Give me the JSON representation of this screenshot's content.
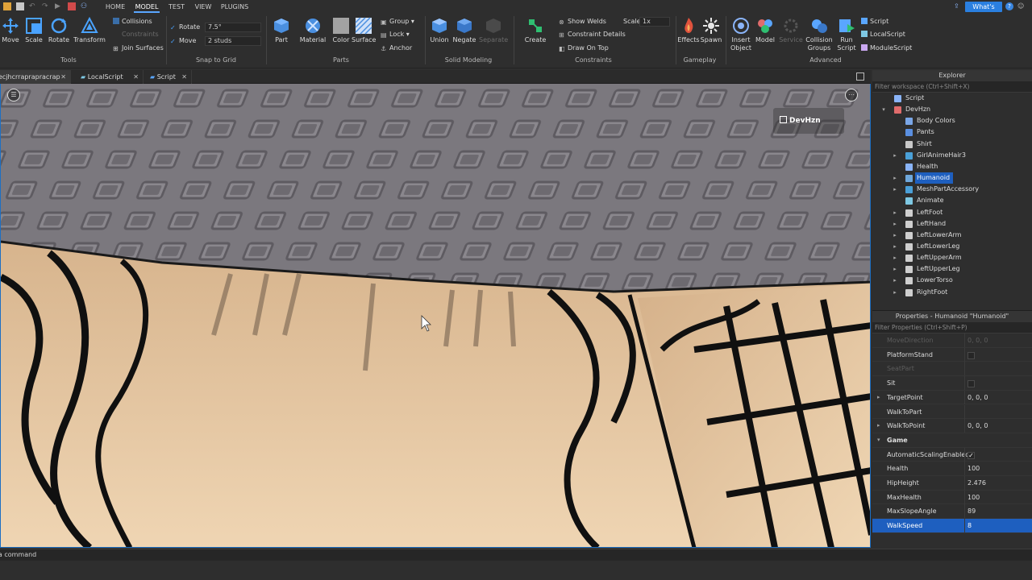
{
  "menu": {
    "tabs": [
      "HOME",
      "MODEL",
      "TEST",
      "VIEW",
      "PLUGINS"
    ],
    "active_tab": "MODEL",
    "whats_new": "What's New"
  },
  "ribbon": {
    "tools": {
      "move": "Move",
      "scale": "Scale",
      "rotate": "Rotate",
      "transform": "Transform",
      "collisions": "Collisions",
      "constraints": "Constraints",
      "join_surfaces": "Join Surfaces",
      "title": "Tools"
    },
    "snap": {
      "rotate_label": "Rotate",
      "rotate_value": "7.5°",
      "move_label": "Move",
      "move_value": "2 studs",
      "title": "Snap to Grid"
    },
    "parts": {
      "part": "Part",
      "material": "Material",
      "color": "Color",
      "surface": "Surface",
      "group": "Group",
      "lock": "Lock",
      "anchor": "Anchor",
      "title": "Parts"
    },
    "solid": {
      "union": "Union",
      "negate": "Negate",
      "separate": "Separate",
      "title": "Solid Modeling"
    },
    "constraints": {
      "create": "Create",
      "show_welds": "Show Welds",
      "scale_label": "Scale",
      "scale_value": "1x",
      "constraint_details": "Constraint Details",
      "draw_on_top": "Draw On Top",
      "title": "Constraints"
    },
    "gameplay": {
      "effects": "Effects",
      "spawn": "Spawn",
      "title": "Gameplay"
    },
    "advanced": {
      "insert_object": "Insert Object",
      "model": "Model",
      "service": "Service",
      "collision_groups": "Collision Groups",
      "run_script": "Run Script",
      "script": "Script",
      "local_script": "LocalScript",
      "module_script": "ModuleScript",
      "title": "Advanced"
    }
  },
  "doc_tabs": [
    {
      "label": "ecjhcrraprapracrap"
    },
    {
      "label": "LocalScript"
    },
    {
      "label": "Script"
    }
  ],
  "viewport": {
    "badge": "DevHzn"
  },
  "explorer": {
    "title": "Explorer",
    "filter_placeholder": "Filter workspace (Ctrl+Shift+X)",
    "items": [
      {
        "label": "Script",
        "icon": "script-icon",
        "color": "#8ab4f8"
      },
      {
        "label": "DevHzn",
        "icon": "model-icon",
        "color": "#e06c6c"
      },
      {
        "label": "Body Colors",
        "icon": "body-colors-icon",
        "color": "#7aa6e6"
      },
      {
        "label": "Pants",
        "icon": "pants-icon",
        "color": "#5a8fe0"
      },
      {
        "label": "Shirt",
        "icon": "shirt-icon",
        "color": "#c8c8c8"
      },
      {
        "label": "GirlAnimeHair3",
        "icon": "accessory-icon",
        "color": "#4aa0d8"
      },
      {
        "label": "Health",
        "icon": "script-icon",
        "color": "#8ab4f8"
      },
      {
        "label": "Humanoid",
        "icon": "humanoid-icon",
        "color": "#6fa8dc"
      },
      {
        "label": "MeshPartAccessory",
        "icon": "accessory-icon",
        "color": "#4aa0d8"
      },
      {
        "label": "Animate",
        "icon": "localscript-icon",
        "color": "#7ec8e3"
      },
      {
        "label": "LeftFoot",
        "icon": "meshpart-icon",
        "color": "#cfcfcf"
      },
      {
        "label": "LeftHand",
        "icon": "meshpart-icon",
        "color": "#cfcfcf"
      },
      {
        "label": "LeftLowerArm",
        "icon": "meshpart-icon",
        "color": "#cfcfcf"
      },
      {
        "label": "LeftLowerLeg",
        "icon": "meshpart-icon",
        "color": "#cfcfcf"
      },
      {
        "label": "LeftUpperArm",
        "icon": "meshpart-icon",
        "color": "#cfcfcf"
      },
      {
        "label": "LeftUpperLeg",
        "icon": "meshpart-icon",
        "color": "#cfcfcf"
      },
      {
        "label": "LowerTorso",
        "icon": "meshpart-icon",
        "color": "#cfcfcf"
      },
      {
        "label": "RightFoot",
        "icon": "meshpart-icon",
        "color": "#cfcfcf"
      }
    ]
  },
  "properties": {
    "title": "Properties - Humanoid \"Humanoid\"",
    "filter_placeholder": "Filter Properties (Ctrl+Shift+P)",
    "rows": [
      {
        "name": "MoveDirection",
        "value": "0, 0, 0",
        "disabled": true
      },
      {
        "name": "PlatformStand",
        "check": false
      },
      {
        "name": "SeatPart",
        "value": "",
        "disabled": true
      },
      {
        "name": "Sit",
        "check": false
      },
      {
        "name": "TargetPoint",
        "value": "0, 0, 0",
        "expandable": true
      },
      {
        "name": "WalkToPart",
        "value": ""
      },
      {
        "name": "WalkToPoint",
        "value": "0, 0, 0",
        "expandable": true
      },
      {
        "name": "Game",
        "category": true
      },
      {
        "name": "AutomaticScalingEnabled",
        "check": true
      },
      {
        "name": "Health",
        "value": "100"
      },
      {
        "name": "HipHeight",
        "value": "2.476"
      },
      {
        "name": "MaxHealth",
        "value": "100"
      },
      {
        "name": "MaxSlopeAngle",
        "value": "89"
      },
      {
        "name": "WalkSpeed",
        "value": "8",
        "selected": true
      }
    ]
  },
  "command": {
    "placeholder": "Run a command"
  },
  "colors": {
    "accent": "#1e5fbf",
    "whats_new": "#2a7fe0",
    "skin": "#d9b48c",
    "baseplate": "#7d7a80"
  }
}
